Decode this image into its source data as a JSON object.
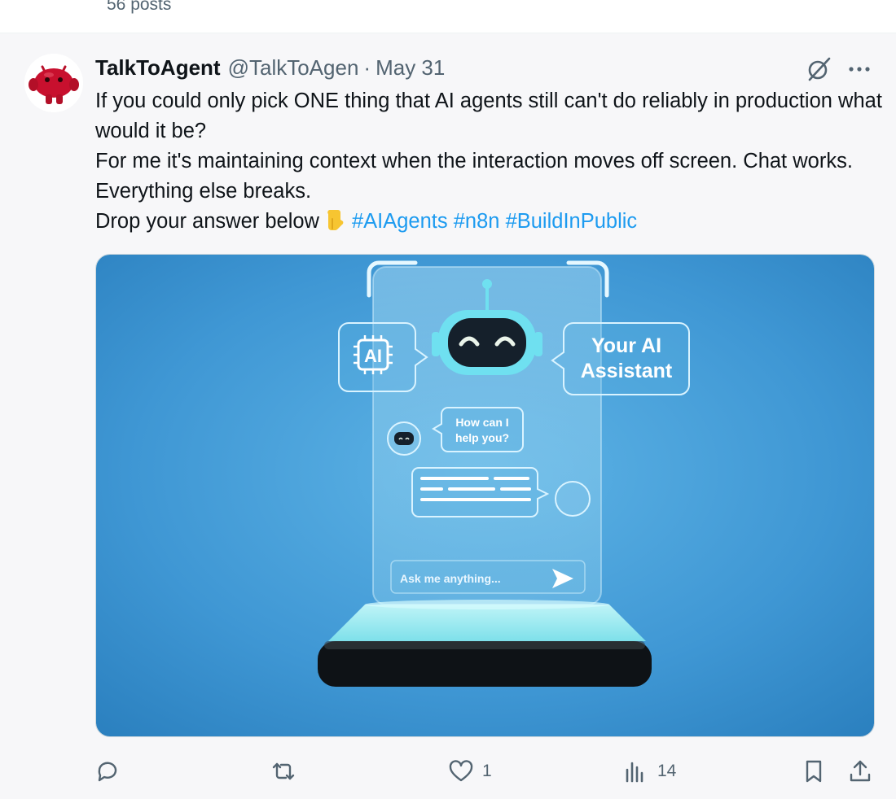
{
  "profile_header": {
    "posts_count": "56 posts"
  },
  "post": {
    "display_name": "TalkToAgent",
    "handle": "@TalkToAgen",
    "separator": "·",
    "date": "May 31",
    "text_line1": "If you could only pick ONE thing that AI agents still can't do reliably in production what would it be?",
    "text_line2": "For me it's maintaining context when the interaction moves off screen. Chat works. Everything else breaks.",
    "text_line3_prefix": "Drop your answer below",
    "hashtags": [
      "#AIAgents",
      "#n8n",
      "#BuildInPublic"
    ],
    "image_text": {
      "chip": "AI",
      "assistant_line1": "Your AI",
      "assistant_line2": "Assistant",
      "greet_line1": "How can I",
      "greet_line2": "help you?",
      "input_placeholder": "Ask me anything..."
    }
  },
  "actions": {
    "reply_count": "",
    "repost_count": "",
    "like_count": "1",
    "views_count": "14"
  },
  "icons": {
    "reply": "reply-icon",
    "repost": "repost-icon",
    "like": "heart-icon",
    "views": "views-icon",
    "bookmark": "bookmark-icon",
    "share": "share-icon",
    "grok": "grok-icon",
    "more": "more-icon",
    "emoji": "pointing-down-emoji"
  },
  "colors": {
    "hashtag": "#1d9bf0",
    "secondary_text": "#536471",
    "image_background": "#3a8fcf",
    "avatar_red": "#c8102e"
  }
}
